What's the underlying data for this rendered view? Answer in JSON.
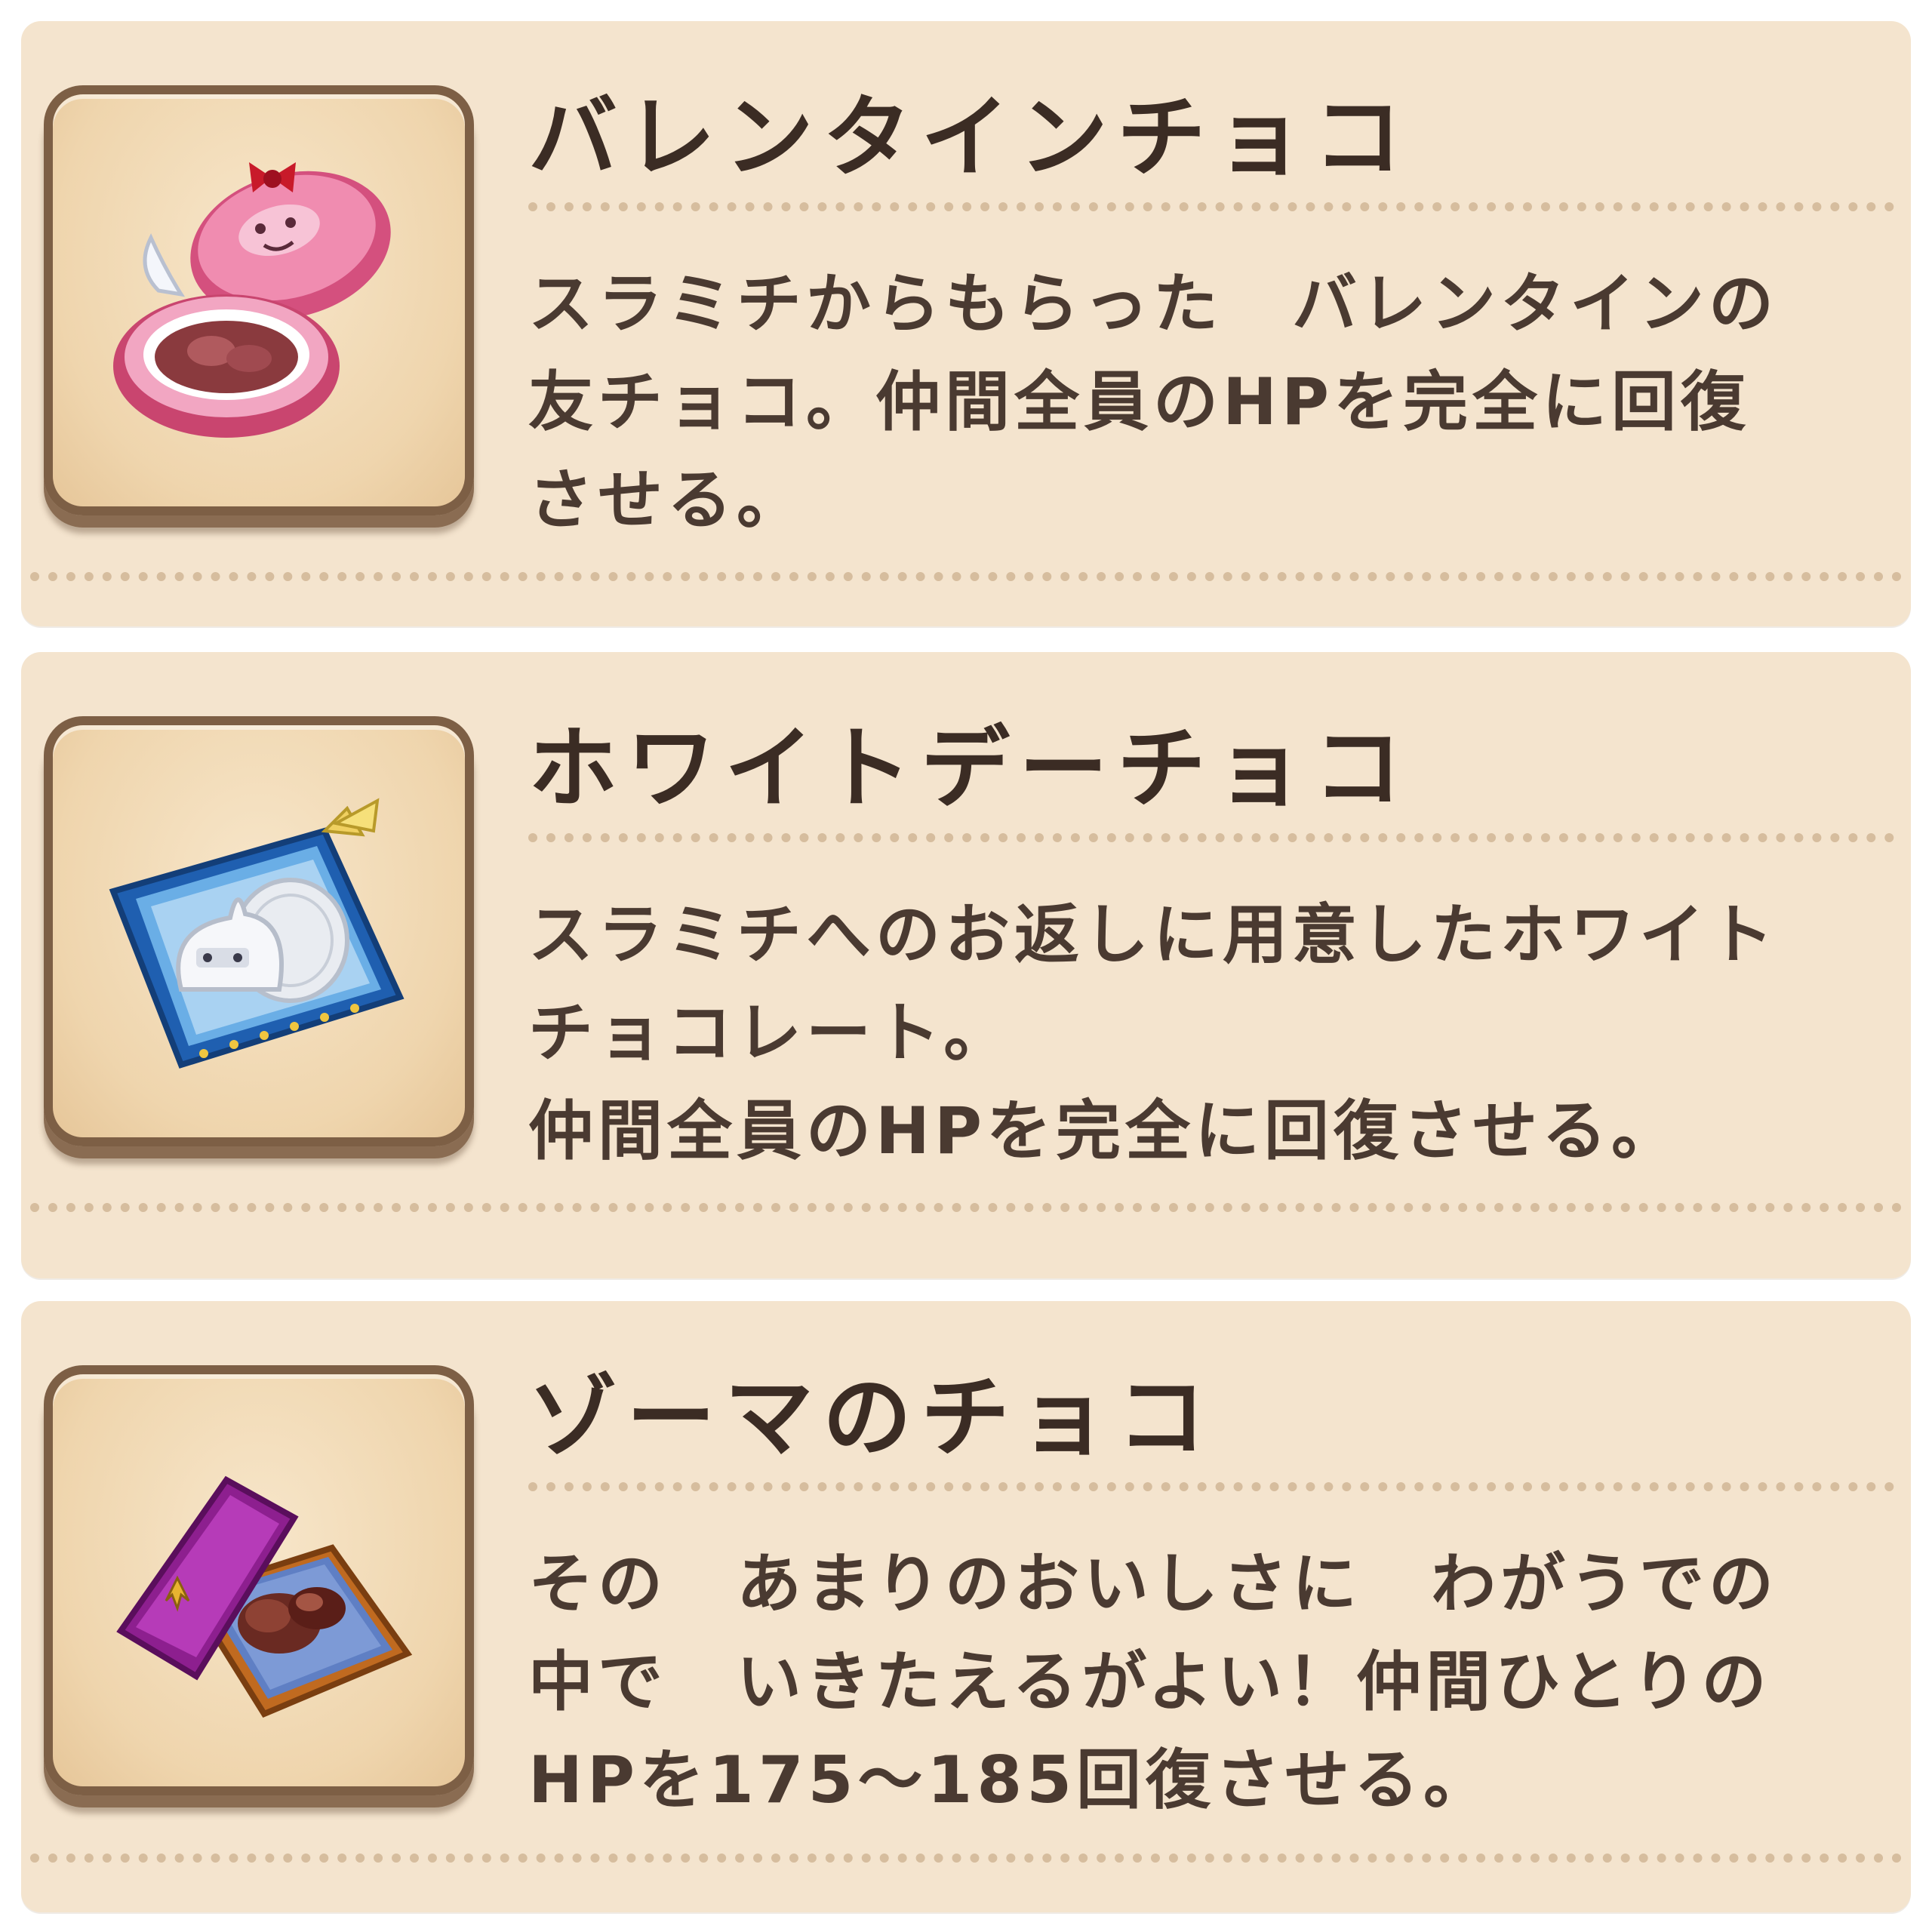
{
  "items": [
    {
      "title": "バレンタインチョコ",
      "icon": "pink-heart-chocolate-box-icon",
      "lines": [
        "スラミチからもらった　バレンタインの",
        "友チョコ。仲間全員のHPを完全に回復",
        "させる。"
      ]
    },
    {
      "title": "ホワイトデーチョコ",
      "icon": "blue-white-chocolate-box-icon",
      "lines": [
        "スラミチへのお返しに用意したホワイト",
        "チョコレート。",
        "仲間全員のHPを完全に回復させる。"
      ]
    },
    {
      "title": "ゾーマのチョコ",
      "icon": "purple-chocolate-box-icon",
      "lines": [
        "その　あまりのおいしさに　わがうでの",
        "中で　いきたえるがよい！仲間ひとりの",
        "HPを175～185回復させる。"
      ]
    }
  ]
}
